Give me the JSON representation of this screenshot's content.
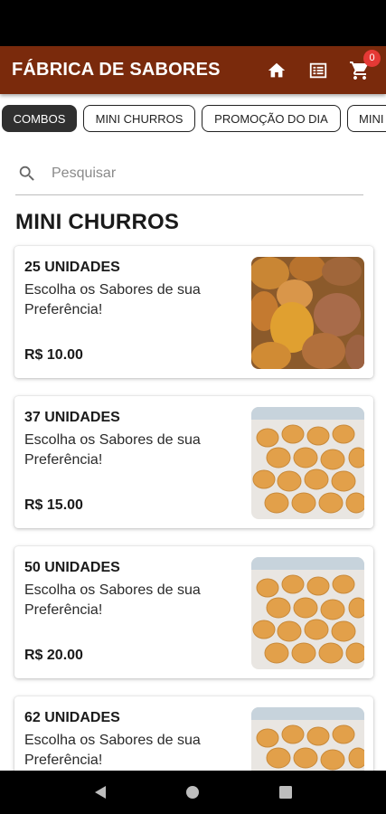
{
  "app": {
    "title": "FÁBRICA DE SABORES",
    "cart_count": "0",
    "brand_color": "#7a2a0c"
  },
  "icons": {
    "home": "home-icon",
    "menu": "list-icon",
    "cart": "cart-icon",
    "search": "search-icon",
    "back": "back-icon",
    "home_nav": "home-nav-icon",
    "recents": "recents-icon"
  },
  "chips": [
    {
      "label": "COMBOS",
      "active": true
    },
    {
      "label": "MINI CHURROS",
      "active": false
    },
    {
      "label": "PROMOÇÃO DO DIA",
      "active": false
    },
    {
      "label": "MINI",
      "active": false
    }
  ],
  "search": {
    "placeholder": "Pesquisar"
  },
  "section": {
    "title": "MINI CHURROS"
  },
  "products": [
    {
      "title": "25 UNIDADES",
      "description": "Escolha os Sabores de sua Preferência!",
      "price": "R$ 10.00"
    },
    {
      "title": "37 UNIDADES",
      "description": "Escolha os Sabores de sua Preferência!",
      "price": "R$ 15.00"
    },
    {
      "title": "50 UNIDADES",
      "description": "Escolha os Sabores de sua Preferência!",
      "price": "R$ 20.00"
    },
    {
      "title": "62 UNIDADES",
      "description": "Escolha os Sabores de sua Preferência!",
      "price": ""
    }
  ]
}
